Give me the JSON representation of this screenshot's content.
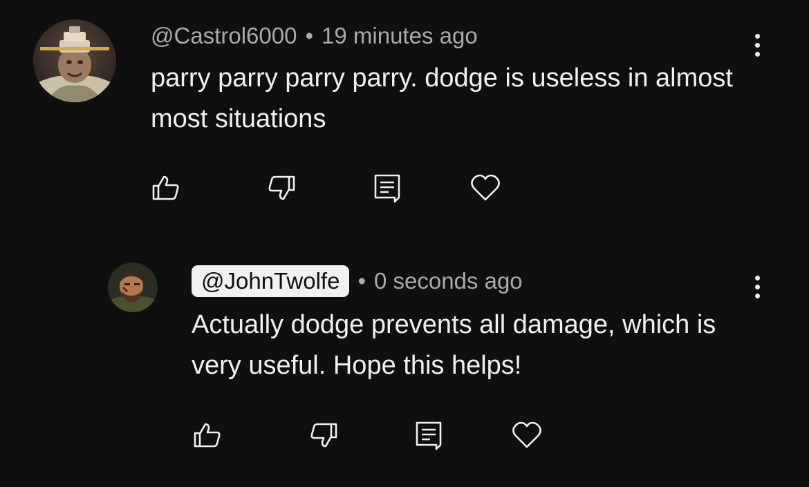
{
  "comments": [
    {
      "handle": "@Castrol6000",
      "separator": "•",
      "time": "19 minutes ago",
      "text": "parry parry parry parry. dodge is useless in almost most situations",
      "avatar_icon": "statue-avatar-icon"
    },
    {
      "handle": "@JohnTwolfe",
      "separator": "•",
      "time": "0 seconds ago",
      "text": "Actually dodge prevents all damage, which is very useful. Hope this helps!",
      "avatar_icon": "bearded-man-avatar-icon"
    }
  ],
  "actions": [
    "thumbs-up-icon",
    "thumbs-down-icon",
    "reply-comment-icon",
    "heart-icon",
    "more-options-icon"
  ],
  "colors": {
    "background": "#0f0f0f",
    "primary_text": "#f1f1f1",
    "secondary_text": "#aaaaaa",
    "pill_background": "#f1f1f1"
  }
}
